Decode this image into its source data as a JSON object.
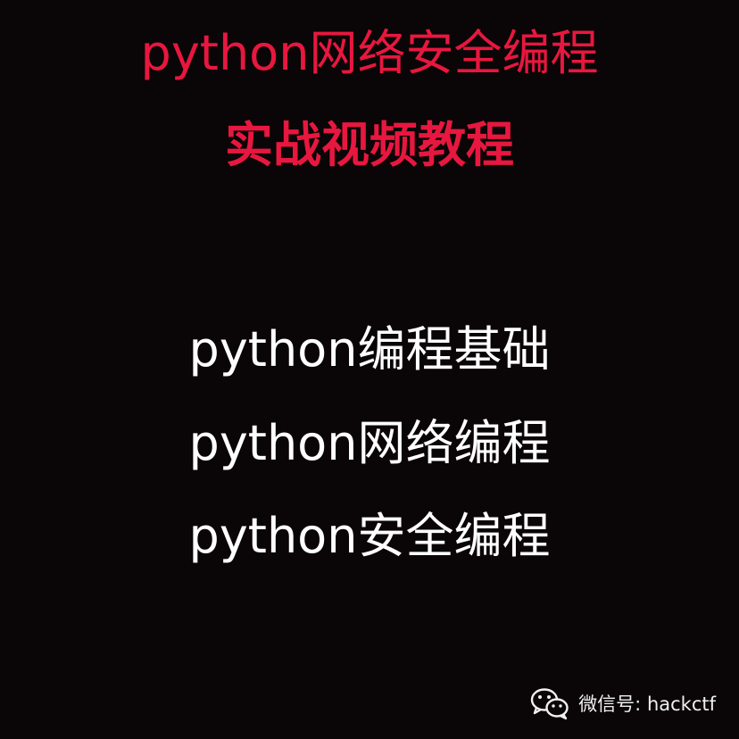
{
  "colors": {
    "background": "#0a0506",
    "title": "#e8173f",
    "body_text": "#ffffff",
    "footer_text": "#f0f0f0"
  },
  "title": {
    "line1": "python网络安全编程",
    "line2": "实战视频教程"
  },
  "topics": [
    "python编程基础",
    "python网络编程",
    "python安全编程"
  ],
  "footer": {
    "icon": "wechat-icon",
    "text": "微信号: hackctf"
  }
}
